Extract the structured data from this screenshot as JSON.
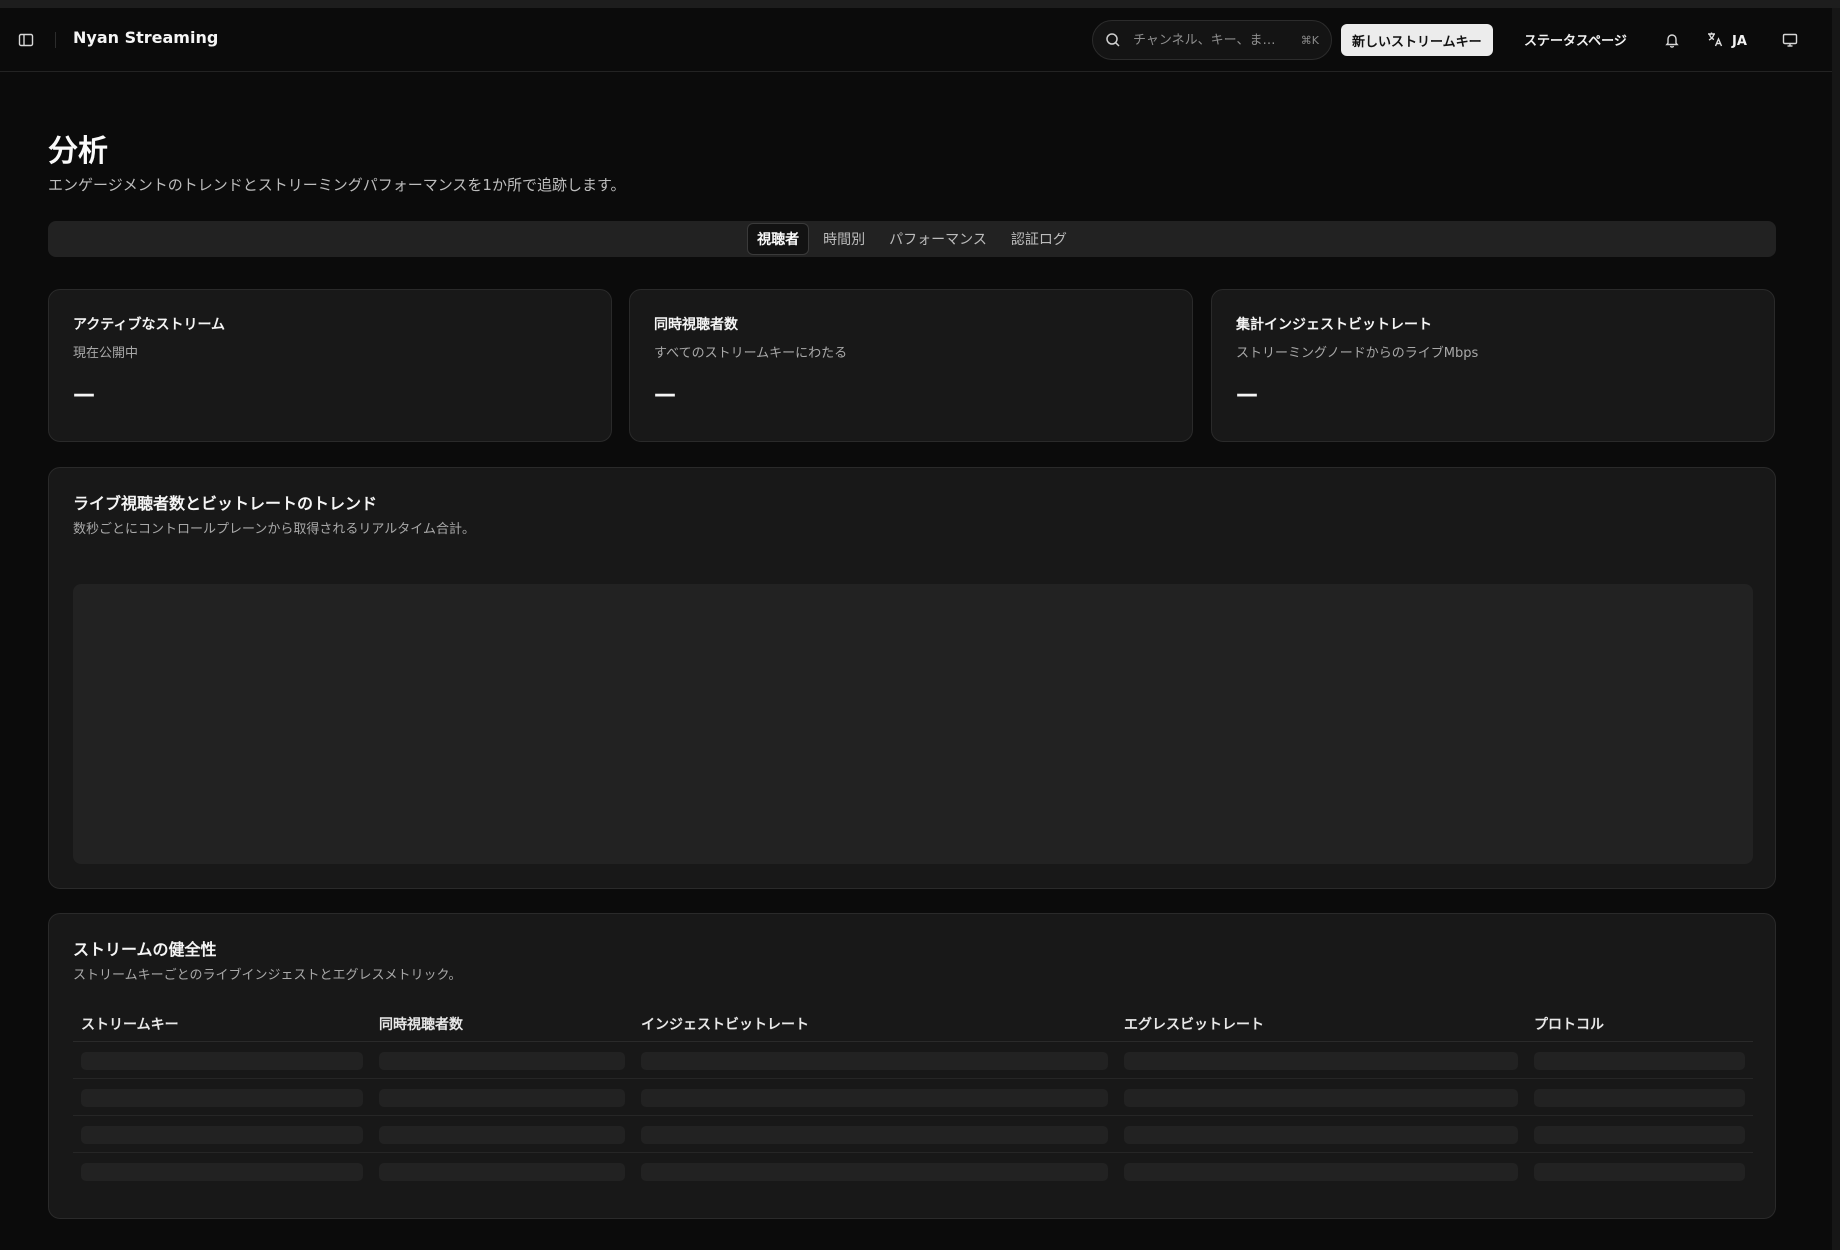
{
  "header": {
    "brand": "Nyan Streaming",
    "search_placeholder": "チャンネル、キー、ま…",
    "search_shortcut": "⌘K",
    "new_button": "新しいストリームキー",
    "status_link": "ステータスページ",
    "language": "JA"
  },
  "page": {
    "title": "分析",
    "subtitle": "エンゲージメントのトレンドとストリーミングパフォーマンスを1か所で追跡します。"
  },
  "tabs": [
    {
      "label": "視聴者",
      "active": true
    },
    {
      "label": "時間別",
      "active": false
    },
    {
      "label": "パフォーマンス",
      "active": false
    },
    {
      "label": "認証ログ",
      "active": false
    }
  ],
  "stats": [
    {
      "title": "アクティブなストリーム",
      "desc": "現在公開中",
      "value": "—"
    },
    {
      "title": "同時視聴者数",
      "desc": "すべてのストリームキーにわたる",
      "value": "—"
    },
    {
      "title": "集計インジェストビットレート",
      "desc": "ストリーミングノードからのライブMbps",
      "value": "—"
    }
  ],
  "trend": {
    "title": "ライブ視聴者数とビットレートのトレンド",
    "desc": "数秒ごとにコントロールプレーンから取得されるリアルタイム合計。"
  },
  "health": {
    "title": "ストリームの健全性",
    "desc": "ストリームキーごとのライブインジェストとエグレスメトリック。",
    "columns": [
      "ストリームキー",
      "同時視聴者数",
      "インジェストビットレート",
      "エグレスビットレート",
      "プロトコル"
    ]
  }
}
